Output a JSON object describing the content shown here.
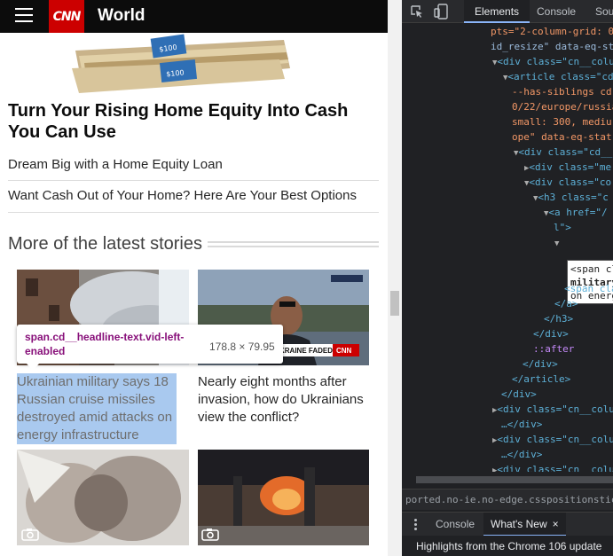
{
  "header": {
    "logo_text": "CNN",
    "section_title": "World"
  },
  "promo": {
    "headline": "Turn Your Rising Home Equity Into Cash You Can Use",
    "links": [
      "Dream Big with a Home Equity Loan",
      "Want Cash Out of Your Home? Here Are Your Best Options"
    ]
  },
  "latest": {
    "heading": "More of the latest stories",
    "stories": [
      {
        "headline": "Ukrainian military says 18 Russian cruise missiles destroyed amid attacks on energy infrastructure"
      },
      {
        "headline": "Nearly eight months after invasion, how do Ukrainians view the conflict?",
        "overlay_text": "OR UKRAINE FADED?"
      }
    ]
  },
  "inspect_tooltip": {
    "selector": "span.cd__headline-text.vid-left-enabled",
    "size": "178.8 × 79.95"
  },
  "devtools": {
    "tabs": [
      "Elements",
      "Console",
      "Sou"
    ],
    "dom_lines": [
      "pts=\"2-column-grid: 0",
      "id_resize\" data-eq-st",
      "<div class=\"cn__colu",
      "<article class=\"cd",
      "--has-siblings cd-",
      "0/22/europe/russia",
      "small: 300, mediu",
      "ope\" data-eq-stat",
      "<div class=\"cd__",
      "<div class=\"me",
      "<div class=\"co",
      "<h3 class=\"c",
      "<a href=\"/",
      "l\">",
      "<span cl",
      "military",
      "on energ",
      "<span cla",
      "</a>",
      "</h3>",
      "</div>",
      "::after",
      "</div>",
      "</article>",
      "</div>",
      "<div class=\"cn__colu",
      "…</div>",
      "<div class=\"cn__colu",
      "…</div>",
      "<div class=\"cn  colu"
    ],
    "breadcrumb": "ported.no-ie.no-edge.csspositionstickys",
    "drawer": {
      "console_label": "Console",
      "whats_new_label": "What's New",
      "close_glyph": "×",
      "highlight_text": "Highlights from the Chrome 106 update"
    }
  },
  "colors": {
    "cnn_red": "#cc0000",
    "selection_blue": "#a9c9ef",
    "devtools_bg": "#202124",
    "tag_color": "#5db0d7"
  }
}
